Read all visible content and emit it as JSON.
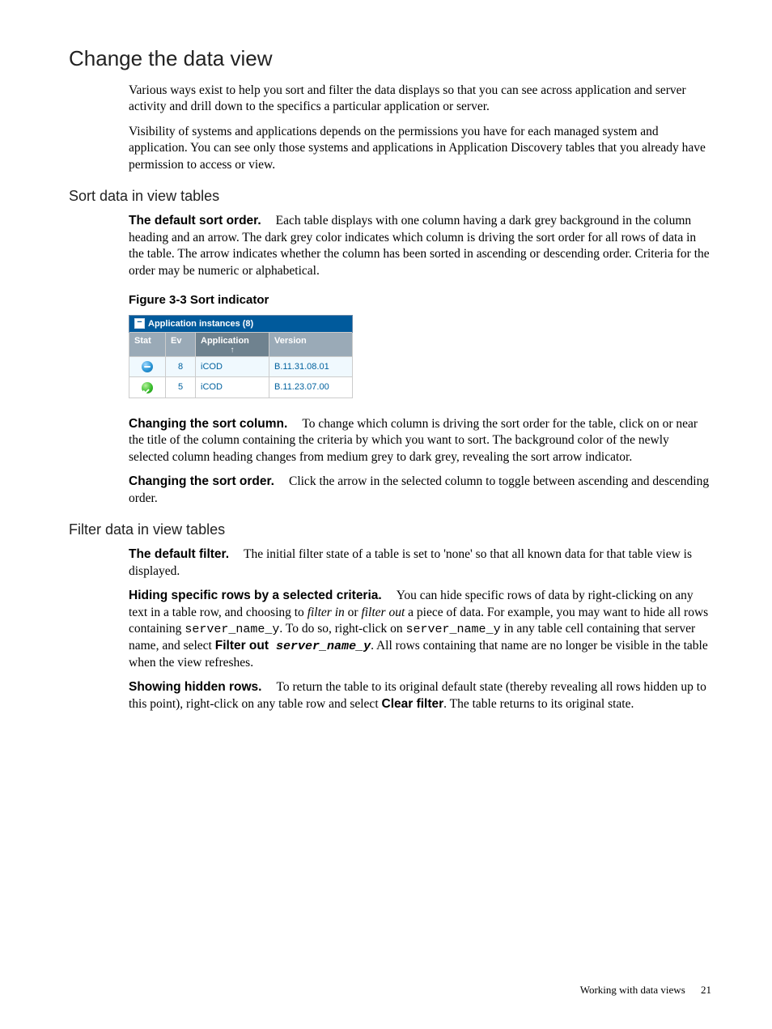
{
  "section": {
    "title": "Change the data view"
  },
  "intro": {
    "p1": "Various ways exist to help you sort and filter the data displays so that you can see across application and server activity and drill down to the specifics a particular application or server.",
    "p2": "Visibility of systems and applications depends on the permissions you have for each managed system and application. You can see only those systems and applications in Application Discovery tables that you already have permission to access or view."
  },
  "sort_section": {
    "title": "Sort data in view tables",
    "default_sort": {
      "runin": "The default sort order.",
      "text": "Each table displays with one column having a dark grey background in the column heading and an arrow. The dark grey color indicates which column is driving the sort order for all rows of data in the table. The arrow indicates whether the column has been sorted in ascending or descending order. Criteria for the order may be numeric or alphabetical."
    },
    "figure_caption": "Figure 3-3 Sort indicator",
    "change_column": {
      "runin": "Changing the sort column.",
      "text": "To change which column is driving the sort order for the table, click on or near the title of the column containing the criteria by which you want to sort. The background color of the newly selected column heading changes from medium grey to dark grey, revealing the sort arrow indicator."
    },
    "change_order": {
      "runin": "Changing the sort order.",
      "text": "Click the arrow in the selected column to toggle between ascending and descending order."
    }
  },
  "filter_section": {
    "title": "Filter data in view tables",
    "default_filter": {
      "runin": "The default filter.",
      "text": "The initial filter state of a table is set to 'none' so that all known data for that table view is displayed."
    },
    "hiding": {
      "runin": "Hiding specific rows by a selected criteria.",
      "t1": "You can hide specific rows of data by right-clicking on any text in a table row, and choosing to ",
      "i1": "filter in",
      "t2": " or ",
      "i2": "filter out",
      "t3": " a piece of data. For example, you may want to hide all rows containing ",
      "m1": "server_name_y",
      "t4": ". To do so, right-click on ",
      "m2": "server_name_y",
      "t5": " in any table cell containing that server name, and select ",
      "b1": "Filter out",
      "m3": " server_name_y",
      "t6": ". All rows containing that name are no longer be visible in the table when the view refreshes."
    },
    "showing": {
      "runin": "Showing hidden rows.",
      "t1": "To return the table to its original default state (thereby revealing all rows hidden up to this point), right-click on any table row and select ",
      "b1": "Clear filter",
      "t2": ". The table returns to its original state."
    }
  },
  "ui_table": {
    "title": "Application instances (8)",
    "headers": {
      "stat": "Stat",
      "ev": "Ev",
      "app": "Application",
      "ver": "Version"
    },
    "rows": [
      {
        "status": "blue",
        "ev": "8",
        "app": "iCOD",
        "ver": "B.11.31.08.01"
      },
      {
        "status": "green",
        "ev": "5",
        "app": "iCOD",
        "ver": "B.11.23.07.00"
      }
    ]
  },
  "footer": {
    "label": "Working with data views",
    "page": "21"
  }
}
